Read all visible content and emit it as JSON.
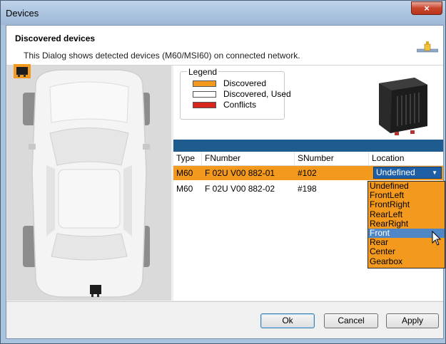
{
  "window": {
    "title": "Devices",
    "close_glyph": "×"
  },
  "header": {
    "title": "Discovered devices",
    "subtitle": "This Dialog shows detected devices (M60/MSI60) on connected network.",
    "icon": "network-plug-icon"
  },
  "legend": {
    "title": "Legend",
    "items": [
      {
        "label": "Discovered",
        "color": "#f39a1e"
      },
      {
        "label": "Discovered, Used",
        "color": "#ffffff"
      },
      {
        "label": "Conflicts",
        "color": "#d7261e"
      }
    ]
  },
  "grid": {
    "columns": [
      "Type",
      "FNumber",
      "SNumber",
      "Location"
    ],
    "rows": [
      {
        "type": "M60",
        "fnumber": "F 02U V00 882-01",
        "snumber": "#102",
        "location": "Undefined"
      },
      {
        "type": "M60",
        "fnumber": "F 02U V00 882-02",
        "snumber": "#198",
        "location": ""
      }
    ]
  },
  "location_dropdown": {
    "options": [
      "Undefined",
      "FrontLeft",
      "FrontRight",
      "RearLeft",
      "RearRight",
      "Front",
      "Rear",
      "Center",
      "Gearbox"
    ],
    "hovered": "Front"
  },
  "buttons": {
    "ok": "Ok",
    "cancel": "Cancel",
    "apply": "Apply"
  },
  "colors": {
    "accent_orange": "#f39a1e",
    "grid_bar_blue": "#1e5c8f",
    "selection_blue": "#1f5fa6"
  }
}
